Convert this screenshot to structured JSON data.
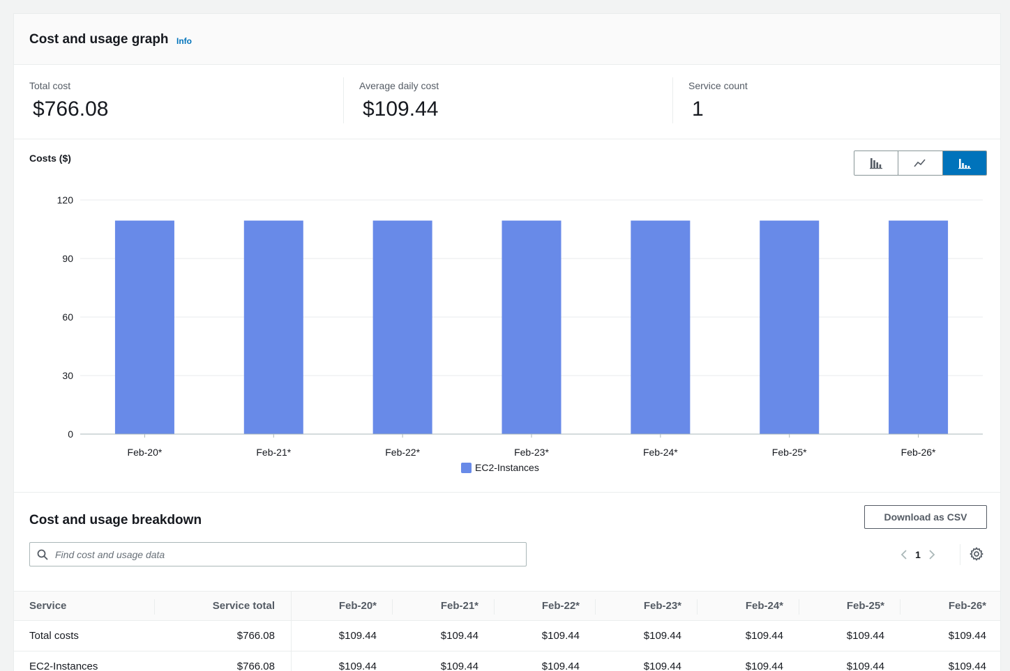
{
  "header": {
    "title": "Cost and usage graph",
    "info_link": "Info"
  },
  "summary": {
    "total_cost": {
      "label": "Total cost",
      "value": "$766.08"
    },
    "average_daily_cost": {
      "label": "Average daily cost",
      "value": "$109.44"
    },
    "service_count": {
      "label": "Service count",
      "value": "1"
    }
  },
  "chart_controls": {
    "options": [
      {
        "icon": "bar-chart-icon",
        "active": false
      },
      {
        "icon": "line-chart-icon",
        "active": false
      },
      {
        "icon": "stacked-bar-chart-icon",
        "active": true
      }
    ]
  },
  "chart_data": {
    "type": "bar",
    "ylabel": "Costs ($)",
    "categories": [
      "Feb-20*",
      "Feb-21*",
      "Feb-22*",
      "Feb-23*",
      "Feb-24*",
      "Feb-25*",
      "Feb-26*"
    ],
    "series": [
      {
        "name": "EC2-Instances",
        "color": "#688ae8",
        "values": [
          109.44,
          109.44,
          109.44,
          109.44,
          109.44,
          109.44,
          109.44
        ]
      }
    ],
    "ylim": [
      0,
      120
    ],
    "yticks": [
      0,
      30,
      60,
      90,
      120
    ],
    "grid": true,
    "legend_position": "bottom-center"
  },
  "breakdown": {
    "title": "Cost and usage breakdown",
    "download_label": "Download as CSV",
    "search_placeholder": "Find cost and usage data",
    "current_page": "1",
    "columns": [
      "Service",
      "Service total",
      "Feb-20*",
      "Feb-21*",
      "Feb-22*",
      "Feb-23*",
      "Feb-24*",
      "Feb-25*",
      "Feb-26*"
    ],
    "rows": [
      [
        "Total costs",
        "$766.08",
        "$109.44",
        "$109.44",
        "$109.44",
        "$109.44",
        "$109.44",
        "$109.44",
        "$109.44"
      ],
      [
        "EC2-Instances",
        "$766.08",
        "$109.44",
        "$109.44",
        "$109.44",
        "$109.44",
        "$109.44",
        "$109.44",
        "$109.44"
      ]
    ]
  },
  "colors": {
    "accent": "#0073bb",
    "bar": "#688ae8",
    "text": "#16191f",
    "muted": "#545b64"
  }
}
